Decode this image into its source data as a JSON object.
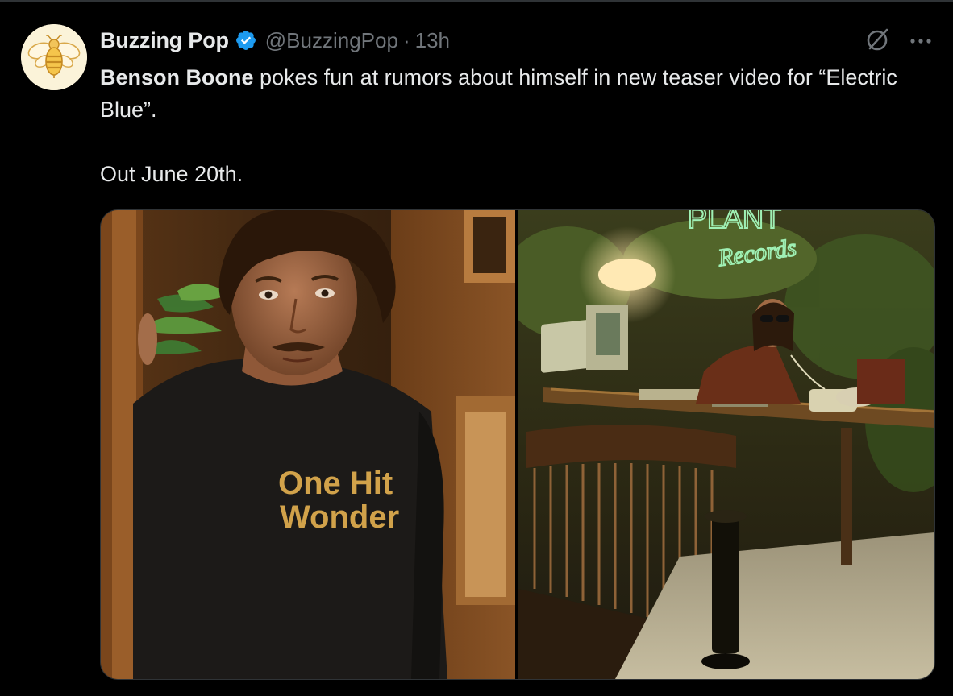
{
  "tweet": {
    "display_name": "Buzzing Pop",
    "handle": "@BuzzingPop",
    "separator": "·",
    "time": "13h",
    "text_bold": "Benson Boone",
    "text_rest": " pokes fun at rumors about himself in new teaser video for “Electric Blue”.",
    "text_line2": "Out June 20th.",
    "shirt_text_line1": "One Hit",
    "shirt_text_line2": "Wonder",
    "sign_text_line1": "PLANT",
    "sign_text_line2": "Records"
  },
  "icons": {
    "avatar": "bee-logo",
    "verified": "verified-badge-icon",
    "grok": "grok-icon",
    "more": "more-icon"
  },
  "colors": {
    "background": "#000000",
    "text_primary": "#e7e9ea",
    "text_secondary": "#71767b",
    "verified_blue": "#1d9bf0",
    "border": "#2f3336"
  }
}
